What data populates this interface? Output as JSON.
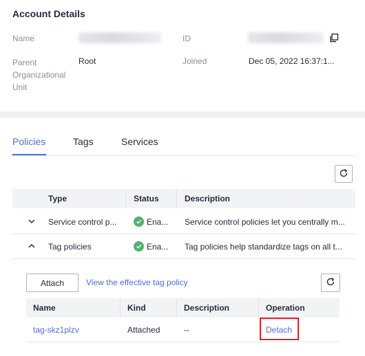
{
  "account": {
    "title": "Account Details",
    "name_label": "Name",
    "id_label": "ID",
    "parent_label": "Parent Organizational Unit",
    "parent_value": "Root",
    "joined_label": "Joined",
    "joined_value": "Dec 05, 2022 16:37:1..."
  },
  "tabs": [
    {
      "label": "Policies",
      "active": true
    },
    {
      "label": "Tags",
      "active": false
    },
    {
      "label": "Services",
      "active": false
    }
  ],
  "policies_table": {
    "headers": {
      "type": "Type",
      "status": "Status",
      "description": "Description"
    },
    "rows": [
      {
        "type": "Service control p...",
        "status": "Ena...",
        "description": "Service control policies let you centrally m...",
        "expanded": false
      },
      {
        "type": "Tag policies",
        "status": "Ena...",
        "description": "Tag policies help standardize tags on all t...",
        "expanded": true
      }
    ]
  },
  "tag_panel": {
    "attach_label": "Attach",
    "effective_link": "View the effective tag policy",
    "headers": {
      "name": "Name",
      "kind": "Kind",
      "description": "Description",
      "operation": "Operation"
    },
    "rows": [
      {
        "name": "tag-skz1plzv",
        "kind": "Attached",
        "description": "--",
        "operation": "Detach"
      }
    ]
  },
  "colors": {
    "accent": "#526ecc",
    "success": "#50b371",
    "highlight": "#e0202a"
  },
  "icons": [
    "copy-icon",
    "refresh-icon",
    "chevron-down-icon",
    "chevron-up-icon",
    "check-circle-icon"
  ]
}
